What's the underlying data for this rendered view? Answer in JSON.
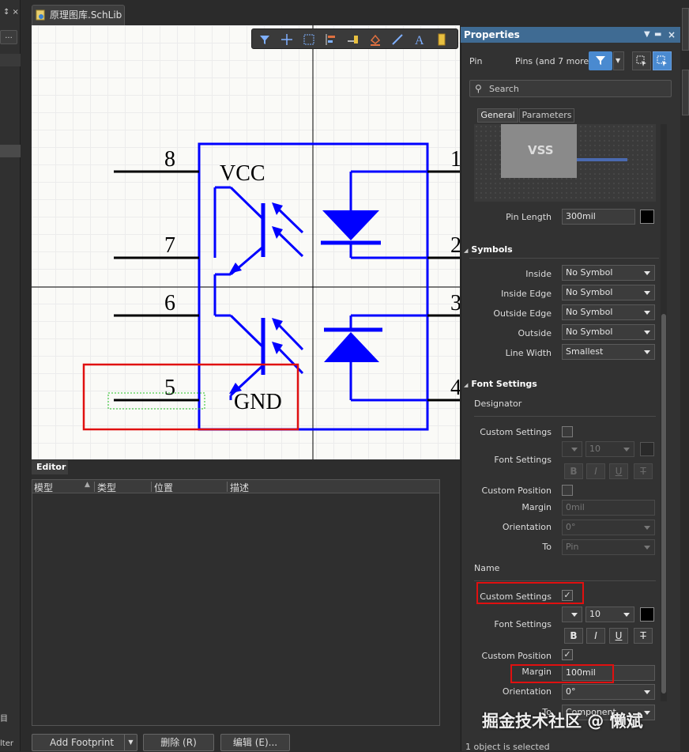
{
  "document": {
    "tab_title": "原理图库.SchLib"
  },
  "schematic": {
    "pin_numbers_left": [
      "8",
      "7",
      "6",
      "5"
    ],
    "pin_numbers_right": [
      "1",
      "2",
      "3",
      "4"
    ],
    "pin_names": {
      "vcc": "VCC",
      "gnd": "GND"
    },
    "colors": {
      "body": "#0000ff",
      "pin": "#000000",
      "selection": "#e01010"
    }
  },
  "toolbar": {
    "icons": [
      "filter-icon",
      "crosshair-icon",
      "select-rect-icon",
      "align-icon",
      "pin-place-icon",
      "fill-icon",
      "line-icon",
      "text-icon",
      "part-icon"
    ]
  },
  "editor": {
    "tab_label": "Editor",
    "columns": [
      "模型",
      "类型",
      "位置",
      "描述"
    ],
    "buttons": {
      "add_footprint": "Add Footprint",
      "delete": "删除 (R)",
      "edit": "编辑 (E)..."
    }
  },
  "left_dock": {
    "ellipsis": "...",
    "bottom_text_1": "目",
    "bottom_text_2": "lter"
  },
  "properties": {
    "title": "Properties",
    "object_kind": "Pin",
    "filter_summary": "Pins (and 7 more)",
    "search_placeholder": "Search",
    "tabs": [
      "General",
      "Parameters"
    ],
    "preview_label": "VSS",
    "pin_length_label": "Pin Length",
    "pin_length_value": "300mil",
    "symbols": {
      "header": "Symbols",
      "rows": [
        {
          "label": "Inside",
          "value": "No Symbol"
        },
        {
          "label": "Inside Edge",
          "value": "No Symbol"
        },
        {
          "label": "Outside Edge",
          "value": "No Symbol"
        },
        {
          "label": "Outside",
          "value": "No Symbol"
        },
        {
          "label": "Line Width",
          "value": "Smallest"
        }
      ]
    },
    "font_settings": {
      "header": "Font Settings",
      "designator": {
        "heading": "Designator",
        "custom_settings_label": "Custom Settings",
        "custom_settings_checked": false,
        "font_settings_label": "Font Settings",
        "font_size": "10",
        "custom_position_label": "Custom Position",
        "custom_position_checked": false,
        "margin_label": "Margin",
        "margin_value": "0mil",
        "orientation_label": "Orientation",
        "orientation_value": "0°",
        "to_label": "To",
        "to_value": "Pin"
      },
      "name": {
        "heading": "Name",
        "custom_settings_label": "Custom Settings",
        "custom_settings_checked": true,
        "font_settings_label": "Font Settings",
        "font_size": "10",
        "custom_position_label": "Custom Position",
        "custom_position_checked": true,
        "margin_label": "Margin",
        "margin_value": "100mil",
        "orientation_label": "Orientation",
        "orientation_value": "0°",
        "to_label": "To",
        "to_value": "Component"
      },
      "format_buttons": [
        "B",
        "I",
        "U",
        "T"
      ]
    },
    "status": "1 object is selected",
    "watermark": "掘金技术社区 @ 懒斌"
  }
}
